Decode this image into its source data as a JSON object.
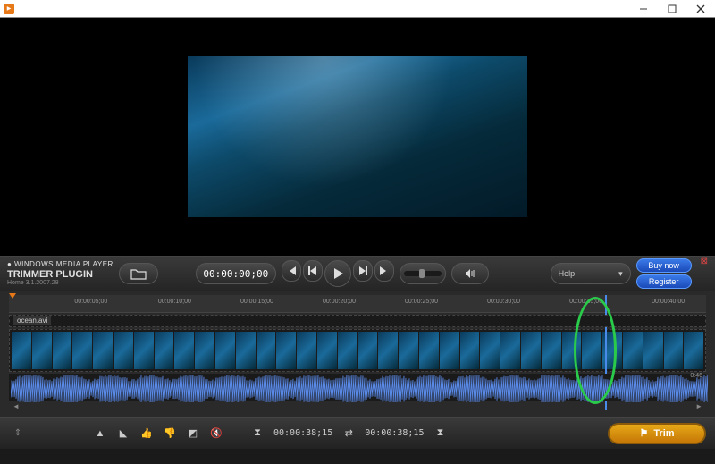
{
  "titlebar": {
    "title": ""
  },
  "brand": {
    "top": "● WINDOWS MEDIA PLAYER",
    "mid": "TRIMMER PLUGIN",
    "bot": "Home 3.1.2007.28"
  },
  "transport": {
    "timecode": "00:00:00;00"
  },
  "help": {
    "label": "Help"
  },
  "buttons": {
    "buy": "Buy now",
    "register": "Register"
  },
  "ruler": {
    "ticks": [
      {
        "t": "00:00:05;00",
        "pct": 9.4
      },
      {
        "t": "00:00:10;00",
        "pct": 21.4
      },
      {
        "t": "00:00:15;00",
        "pct": 33.2
      },
      {
        "t": "00:00:20;00",
        "pct": 45.0
      },
      {
        "t": "00:00:25;00",
        "pct": 56.8
      },
      {
        "t": "00:00:30;00",
        "pct": 68.6
      },
      {
        "t": "00:00:35;00",
        "pct": 80.4
      },
      {
        "t": "00:00:40;00",
        "pct": 92.2
      }
    ],
    "playhead_pct": 85.5
  },
  "clip": {
    "name": "ocean.avi",
    "duration": "0:46"
  },
  "bottom": {
    "tc1": "00:00:38;15",
    "tc2": "00:00:38;15",
    "trim": "Trim"
  }
}
